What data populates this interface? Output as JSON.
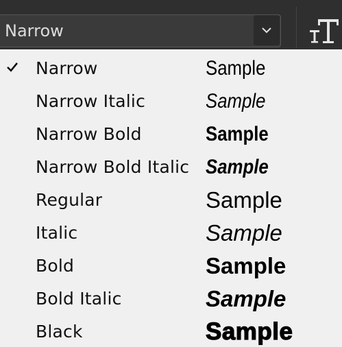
{
  "selector": {
    "value": "Narrow"
  },
  "icons": {
    "dropdown": "chevron-down-icon",
    "type_tool": "type-size-icon",
    "selected": "checkmark-icon"
  },
  "colors": {
    "toolbar_bg": "#2f2f2f",
    "menu_bg": "#f0f0f0",
    "text": "#111111"
  },
  "menu": {
    "items": [
      {
        "label": "Narrow",
        "sample": "Sample",
        "selected": true
      },
      {
        "label": "Narrow Italic",
        "sample": "Sample",
        "selected": false
      },
      {
        "label": "Narrow Bold",
        "sample": "Sample",
        "selected": false
      },
      {
        "label": "Narrow Bold Italic",
        "sample": "Sample",
        "selected": false
      },
      {
        "label": "Regular",
        "sample": "Sample",
        "selected": false
      },
      {
        "label": "Italic",
        "sample": "Sample",
        "selected": false
      },
      {
        "label": "Bold",
        "sample": "Sample",
        "selected": false
      },
      {
        "label": "Bold Italic",
        "sample": "Sample",
        "selected": false
      },
      {
        "label": "Black",
        "sample": "Sample",
        "selected": false
      }
    ]
  }
}
